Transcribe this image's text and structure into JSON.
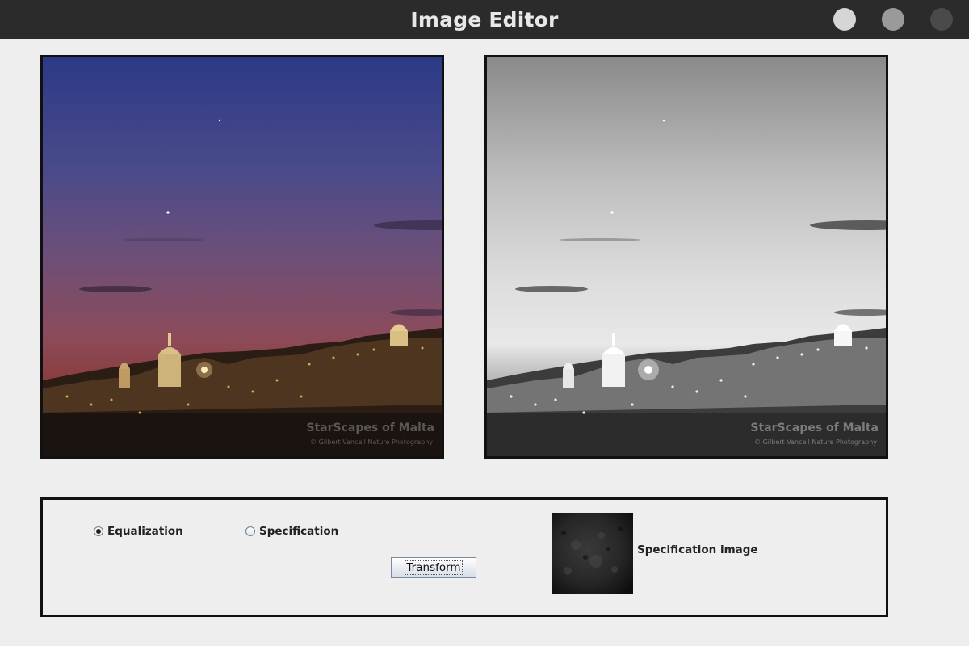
{
  "window": {
    "title": "Image Editor",
    "controls": [
      "close",
      "maximize",
      "minimize"
    ]
  },
  "images": {
    "original": {
      "watermark_title": "StarScapes of Malta",
      "watermark_credit": "© Gilbert Vancell Nature Photography"
    },
    "transformed": {
      "watermark_title": "StarScapes of Malta",
      "watermark_credit": "© Gilbert Vancell Nature Photography"
    }
  },
  "controls": {
    "options": [
      {
        "label": "Equalization",
        "selected": true
      },
      {
        "label": "Specification",
        "selected": false
      }
    ],
    "transform_label": "Transform",
    "spec_image_label": "Specification image"
  },
  "colors": {
    "titlebar": "#2b2b2b",
    "background": "#eeeeee",
    "border": "#111111"
  }
}
